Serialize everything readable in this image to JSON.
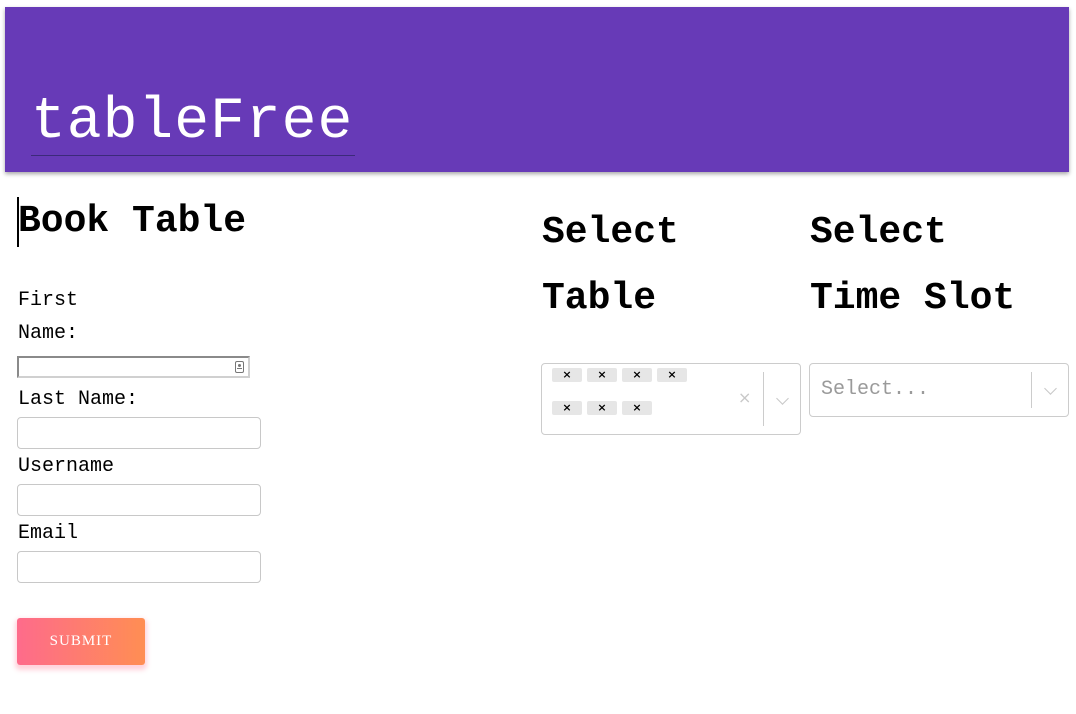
{
  "header": {
    "brand": "tableFree",
    "background": "#673ab7"
  },
  "form": {
    "title": "Book Table",
    "first_name_label_line1": "First",
    "first_name_label_line2": "Name:",
    "first_name_value": "",
    "last_name_label": "Last Name:",
    "last_name_value": "",
    "username_label": "Username",
    "username_value": "",
    "email_label": "Email",
    "email_value": "",
    "submit_label": "SUBMIT"
  },
  "table_select": {
    "heading_line1": "Select",
    "heading_line2": "Table",
    "chips": [
      "×",
      "×",
      "×",
      "×",
      "×",
      "×",
      "×"
    ],
    "clear_icon": "×"
  },
  "time_select": {
    "heading_line1": "Select",
    "heading_line2": "Time Slot",
    "placeholder": "Select..."
  },
  "colors": {
    "submit_gradient_start": "#fe6b8b",
    "submit_gradient_end": "#ff8e53"
  }
}
